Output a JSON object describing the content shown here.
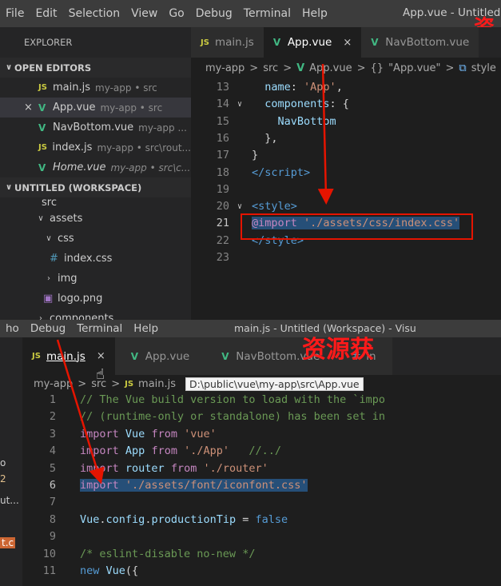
{
  "top": {
    "menu": [
      "File",
      "Edit",
      "Selection",
      "View",
      "Go",
      "Debug",
      "Terminal",
      "Help"
    ],
    "window_title": "App.vue - Untitled (W",
    "watermark": "资",
    "explorer_header": "EXPLORER",
    "open_editors_label": "OPEN EDITORS",
    "open_editors": [
      {
        "icon": "JS",
        "name": "main.js",
        "desc": "my-app • src",
        "active": false,
        "close": ""
      },
      {
        "icon": "V",
        "name": "App.vue",
        "desc": "my-app • src",
        "active": true,
        "close": "×"
      },
      {
        "icon": "V",
        "name": "NavBottom.vue",
        "desc": "my-app ...",
        "active": false,
        "close": ""
      },
      {
        "icon": "JS",
        "name": "index.js",
        "desc": "my-app • src\\rout...",
        "active": false,
        "close": ""
      },
      {
        "icon": "V",
        "name": "Home.vue",
        "desc": "my-app • src\\c...",
        "active": false,
        "close": ""
      }
    ],
    "workspace_label": "UNTITLED (WORKSPACE)",
    "tree": [
      {
        "name": "src",
        "indent": 52,
        "chev": "",
        "icon": ""
      },
      {
        "name": "assets",
        "indent": 44,
        "chev": "∨",
        "icon": ""
      },
      {
        "name": "css",
        "indent": 54,
        "chev": "∨",
        "icon": ""
      },
      {
        "name": "index.css",
        "indent": 62,
        "chev": "",
        "icon": "#"
      },
      {
        "name": "img",
        "indent": 54,
        "chev": "›",
        "icon": ""
      },
      {
        "name": "logo.png",
        "indent": 54,
        "chev": "",
        "icon": "▣"
      },
      {
        "name": "components",
        "indent": 44,
        "chev": "›",
        "icon": ""
      }
    ],
    "tabs": [
      {
        "icon": "JS",
        "label": "main.js",
        "close": "",
        "active": false
      },
      {
        "icon": "V",
        "label": "App.vue",
        "close": "×",
        "active": true
      },
      {
        "icon": "V",
        "label": "NavBottom.vue",
        "close": "",
        "active": false
      }
    ],
    "breadcrumb": [
      "my-app",
      ">",
      "src",
      ">",
      "V",
      "App.vue",
      ">",
      "{}",
      "\"App.vue\"",
      ">",
      "⧉",
      "style"
    ],
    "lines": [
      {
        "n": "13",
        "fold": "",
        "html": "  <span class='k'>name</span>: <span class='str'>'App'</span>,"
      },
      {
        "n": "14",
        "fold": "∨",
        "html": "  <span class='k'>components</span>: {"
      },
      {
        "n": "15",
        "fold": "",
        "html": "    <span class='k'>NavBottom</span>"
      },
      {
        "n": "16",
        "fold": "",
        "html": "  },"
      },
      {
        "n": "17",
        "fold": "",
        "html": "}"
      },
      {
        "n": "18",
        "fold": "",
        "html": "<span class='tag'>&lt;/script&gt;</span>"
      },
      {
        "n": "19",
        "fold": "",
        "html": ""
      },
      {
        "n": "20",
        "fold": "∨",
        "html": "<span class='tag'>&lt;style&gt;</span>"
      },
      {
        "n": "21",
        "fold": "",
        "html": "<span class='sel'><span class='kw'>@import</span> <span class='str'>'./assets/css/index.css'</span></span>"
      },
      {
        "n": "22",
        "fold": "",
        "html": "<span class='tag'>&lt;/style&gt;</span>"
      },
      {
        "n": "23",
        "fold": "",
        "html": ""
      }
    ]
  },
  "bottom": {
    "menu": [
      "ho",
      "Debug",
      "Terminal",
      "Help"
    ],
    "window_title": "main.js - Untitled (Workspace) - Visu",
    "watermark": "资源获",
    "side_fragments": [
      "o",
      "2",
      "ut...",
      "t.c"
    ],
    "tabs": [
      {
        "icon": "JS",
        "label": "main.js",
        "close": "×",
        "active": true
      },
      {
        "icon": "V",
        "label": "App.vue",
        "close": "",
        "active": false
      },
      {
        "icon": "V",
        "label": "NavBottom.vue",
        "close": "",
        "active": false
      },
      {
        "icon": "#",
        "label": "in",
        "close": "",
        "active": false
      }
    ],
    "breadcrumb": [
      "my-app",
      ">",
      "src",
      ">",
      "JS",
      "main.js"
    ],
    "tooltip": "D:\\public\\vue\\my-app\\src\\App.vue",
    "lines": [
      {
        "n": "1",
        "html": "<span class='cm'>// The Vue build version to load with the `impo</span>"
      },
      {
        "n": "2",
        "html": "<span class='cm'>// (runtime-only or standalone) has been set in</span>"
      },
      {
        "n": "3",
        "html": "<span class='kw'>import</span> <span class='k'>Vue</span> <span class='kw'>from</span> <span class='str'>'vue'</span>"
      },
      {
        "n": "4",
        "html": "<span class='kw'>import</span> <span class='k'>App</span> <span class='kw'>from</span> <span class='str'>'./App'</span>   <span class='cm'>//../</span>"
      },
      {
        "n": "5",
        "html": "<span class='kw'>import</span> <span class='k'>router</span> <span class='kw'>from</span> <span class='str'>'./router'</span>"
      },
      {
        "n": "6",
        "html": "<span class='sel'><span class='kw'>import</span> <span class='str'>'./assets/font/iconfont.css'</span></span>"
      },
      {
        "n": "7",
        "html": ""
      },
      {
        "n": "8",
        "html": "<span class='k'>Vue</span>.<span class='k'>config</span>.<span class='k'>productionTip</span> = <span class='bool'>false</span>"
      },
      {
        "n": "9",
        "html": ""
      },
      {
        "n": "10",
        "html": "<span class='cm'>/* eslint-disable no-new */</span>"
      },
      {
        "n": "11",
        "html": "<span class='tag'>new</span> <span class='k'>Vue</span>({"
      }
    ]
  }
}
